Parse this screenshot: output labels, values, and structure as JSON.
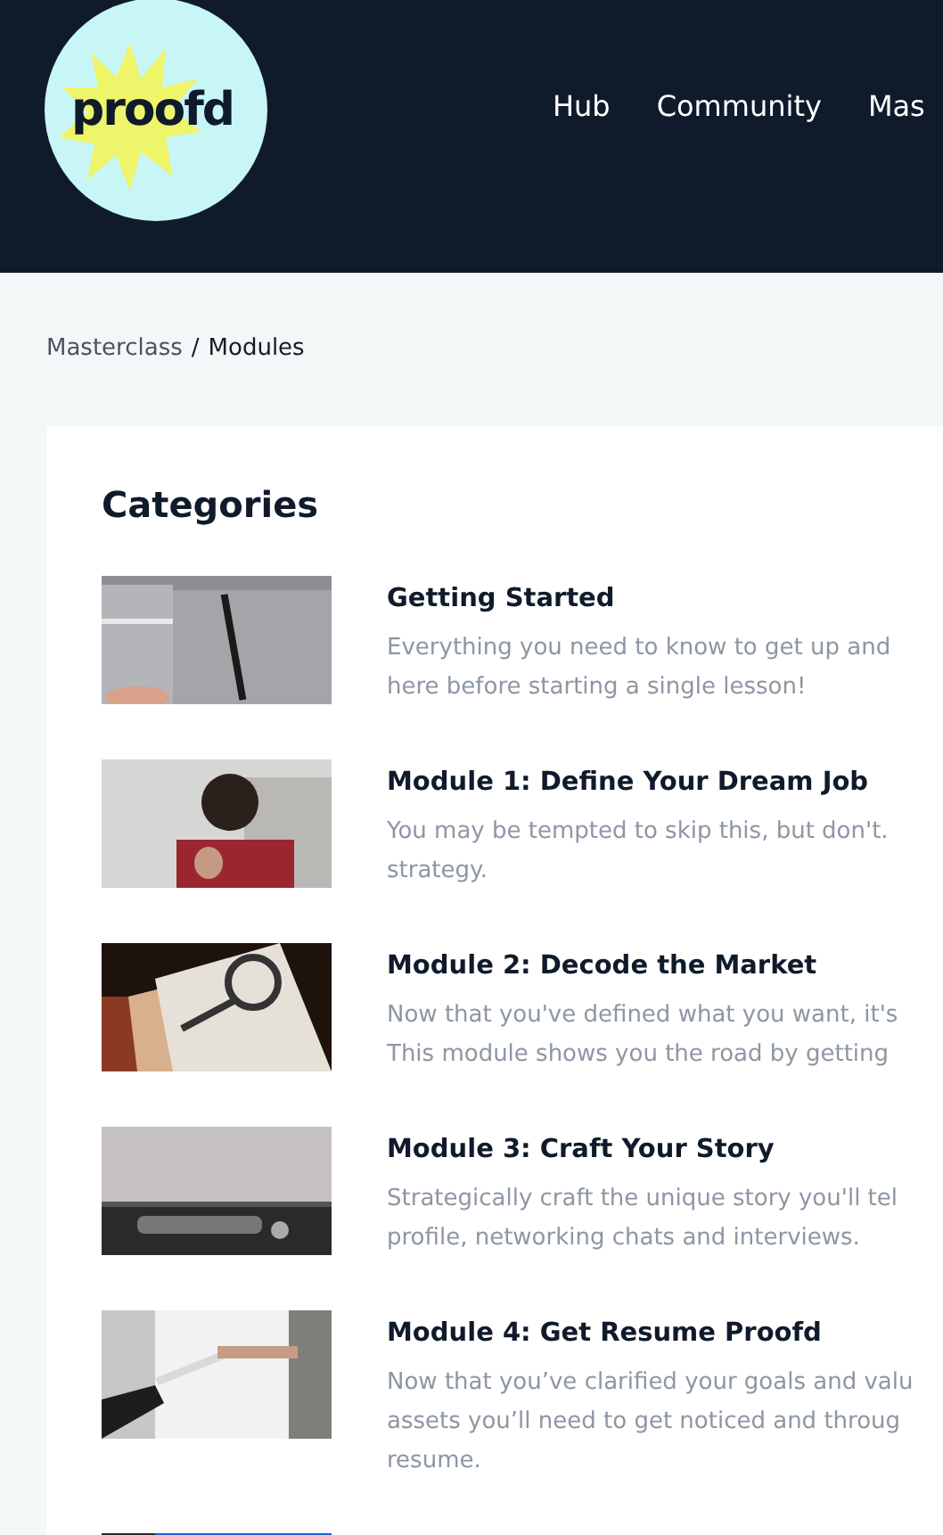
{
  "header": {
    "logo": "proofd",
    "nav": [
      {
        "label": "Hub"
      },
      {
        "label": "Community"
      },
      {
        "label": "Mas"
      }
    ]
  },
  "breadcrumb": {
    "parent": "Masterclass",
    "separator": "/",
    "current": "Modules"
  },
  "categories": {
    "title": "Categories",
    "items": [
      {
        "image": {
          "kind": "picture"
        },
        "title": "Getting Started",
        "lines": [
          "Everything you need to know to get up and",
          "here before starting a single lesson!"
        ]
      },
      {
        "image": {
          "kind": "picture"
        },
        "title": "Module 1: Define Your Dream Job",
        "lines": [
          "You may be tempted to skip this, but don't.",
          "strategy."
        ]
      },
      {
        "image": {
          "kind": "picture"
        },
        "title": "Module 2: Decode the Market",
        "lines": [
          "Now that you've defined what you want, it's",
          "This module shows you the road by getting"
        ]
      },
      {
        "image": {
          "kind": "picture"
        },
        "title": "Module 3: Craft Your Story",
        "lines": [
          "Strategically craft the unique story you'll tel",
          "profile, networking chats and interviews."
        ]
      },
      {
        "image": {
          "kind": "picture"
        },
        "title": "Module 4: Get Resume Proofd",
        "lines": [
          "Now that you’ve clarified your goals and valu",
          "assets you’ll need to get noticed and throug",
          "resume."
        ]
      },
      {
        "image": {
          "kind": "picture"
        }
      }
    ]
  }
}
